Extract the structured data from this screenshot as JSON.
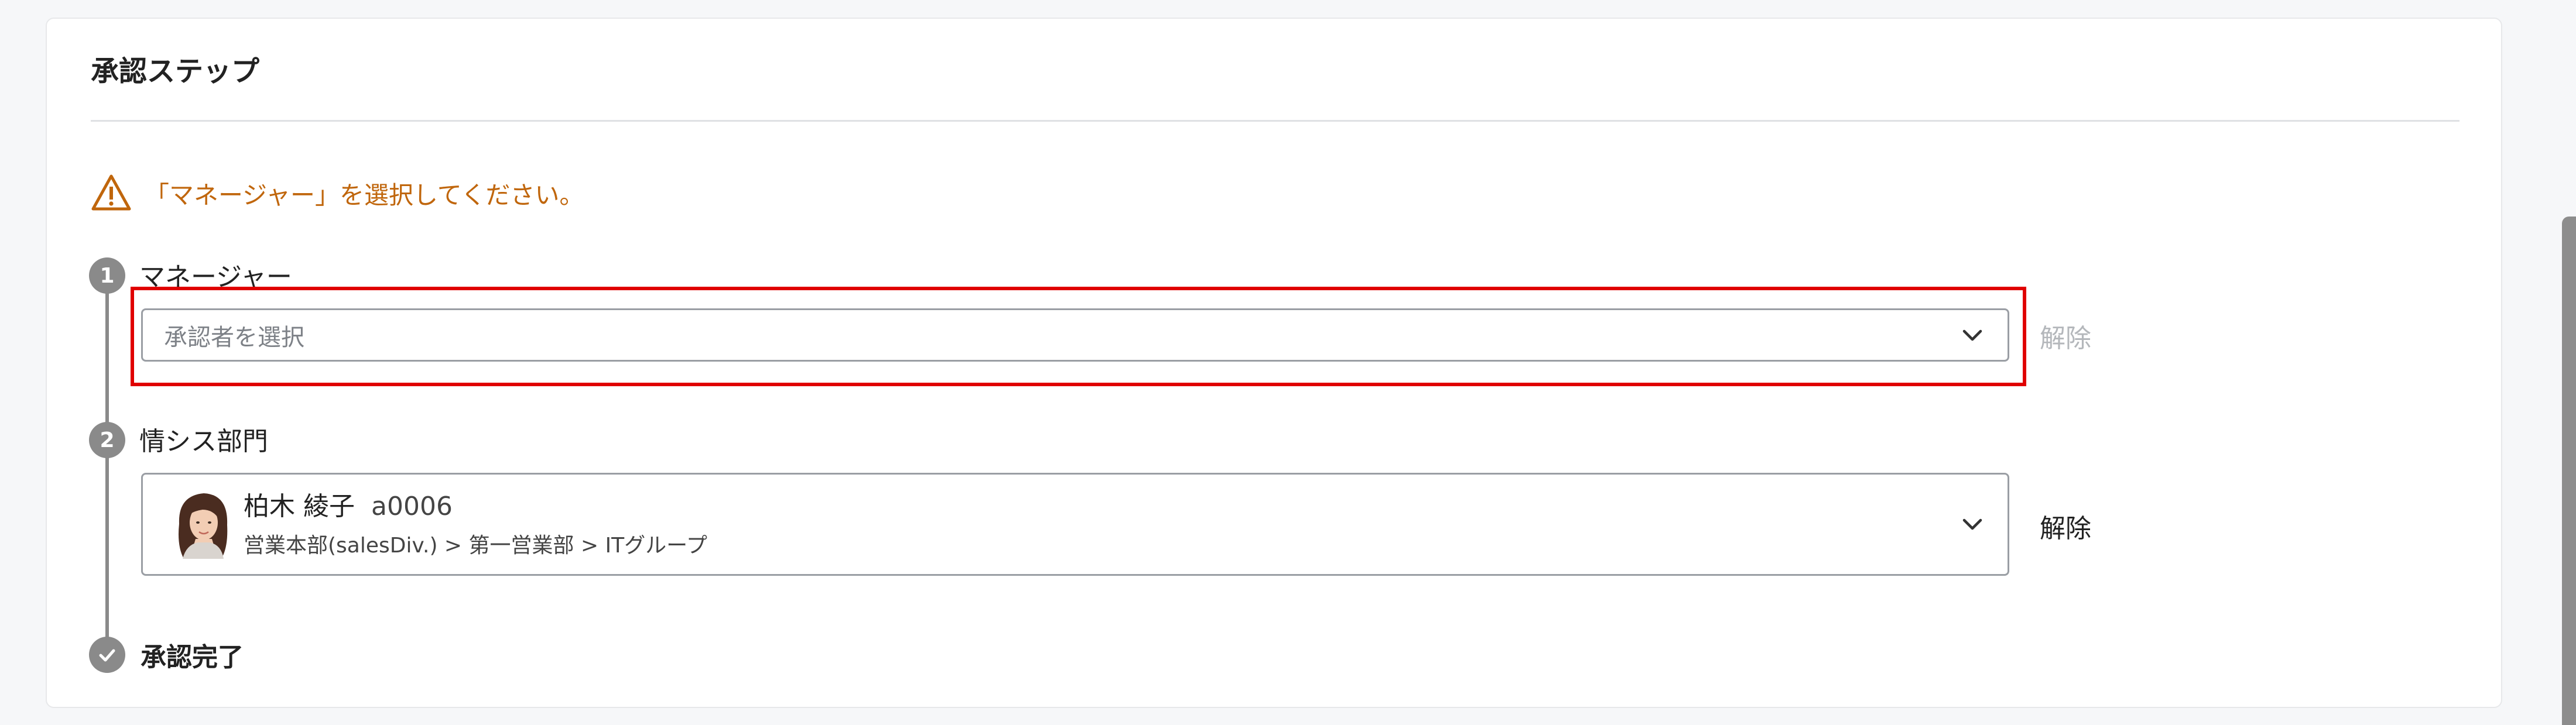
{
  "section": {
    "title": "承認ステップ"
  },
  "warning": {
    "icon": "warning-triangle-icon",
    "text": "「マネージャー」を選択してください。",
    "color": "#c0660c"
  },
  "steps": [
    {
      "number": "1",
      "label": "マネージャー",
      "select": {
        "placeholder": "承認者を選択"
      },
      "clear_label": "解除",
      "clear_enabled": false
    },
    {
      "number": "2",
      "label": "情シス部門",
      "approver": {
        "name": "柏木 綾子",
        "id": "a0006",
        "department": "営業本部(salesDiv.) > 第一営業部 > ITグループ"
      },
      "clear_label": "解除",
      "clear_enabled": true
    }
  ],
  "completion": {
    "label": "承認完了"
  },
  "colors": {
    "highlight": "#e00000",
    "timeline": "#8a8a8a"
  }
}
